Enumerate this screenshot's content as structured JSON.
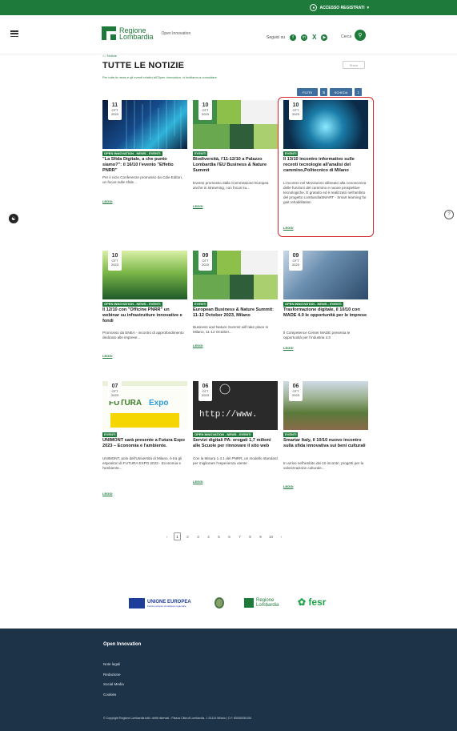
{
  "topbar": {
    "access_label": "ACCESSO REGISTRATI"
  },
  "header": {
    "logo_line1": "Regione",
    "logo_line2": "Lombardia",
    "logo_sub": "Open Innovation",
    "follow_label": "Seguici su",
    "social_icons": [
      "facebook-icon",
      "linkedin-icon",
      "x-icon",
      "youtube-icon"
    ],
    "search_label": "Cerca"
  },
  "page": {
    "breadcrumb": "/ Notizie",
    "title": "TUTTE LE NOTIZIE",
    "share_label": "Share"
  },
  "toolbar": {
    "filter_label": "FILTRI",
    "view_label": "SCHEDA"
  },
  "cards": [
    {
      "day": "11",
      "month": "OTT",
      "year": "2023",
      "tag": "OPEN INNOVATION - NEWS - EVENTI",
      "title": "\"La Sfida Digitale, a che punto siamo?\": il 16/10 l'evento \"Effetto PNRR\"",
      "text": "Per il ciclo Conferenze promosso da Cdie Editori, un focus sulle sfide...",
      "read": "LEGGI"
    },
    {
      "day": "10",
      "month": "OTT",
      "year": "2023",
      "tag": "EVENTI",
      "title": "Biodiversità, l'11-12/10 a Palazzo Lombardia l'EU Business & Nature Summit",
      "text": "Evento promosso dalla Commissione Europea anche in streaming, con focus su...",
      "read": "LEGGI"
    },
    {
      "day": "10",
      "month": "OTT",
      "year": "2023",
      "tag": "EVENTI",
      "title": "Il 13/10 incontro informativo sulle recenti tecnologie all'analisi del cammino,Politecnico di Milano",
      "text": "L'incontro nel Mezzanino allineato alla conoscenza delle funzioni del cammino e nuove prospettive tecnologiche. È gratuito ed è realizzato nell'ambito del progetto LombardiaSMART - Smart learning for gait rehabilitation",
      "read": "LEGGI"
    },
    {
      "day": "10",
      "month": "OTT",
      "year": "2023",
      "tag": "OPEN INNOVATION - NEWS - EVENTI",
      "title": "Il 12/10 con \"Officine PNRR\" un webinar su infrastrutture innovative e fondi",
      "text": "Promosso da ENEA - incontro di approfondimento dedicato alle imprese...",
      "read": "LEGGI"
    },
    {
      "day": "09",
      "month": "OTT",
      "year": "2023",
      "tag": "EVENTI",
      "title": "European Business & Nature Summit: 11-12 October 2023, Milano",
      "text": "Business and Nature Summit will take place in Milano, 11-12 October...",
      "read": "LEGGI"
    },
    {
      "day": "09",
      "month": "OTT",
      "year": "2023",
      "tag": "OPEN INNOVATION - NEWS - EVENTI",
      "title": "Trasformazione digitale, il 10/10 con MADE 4.0 le opportunità per le imprese",
      "text": "Il Competence Center MADE presenta le opportunità per l'industria 4.0",
      "read": "LEGGI"
    },
    {
      "day": "07",
      "month": "OTT",
      "year": "2023",
      "tag": "EVENTI",
      "title": "UNIMONT sarà presente a Futura Expo 2023 – Economia e l'ambiente.",
      "text": "UNIMONT, polo dell'Università di Milano, è tra gli espositori di FUTURA EXPO 2023 - Economia e l'ambiente...",
      "read": "LEGGI"
    },
    {
      "day": "06",
      "month": "OTT",
      "year": "2023",
      "tag": "OPEN INNOVATION - NEWS - EVENTI",
      "title": "Servizi digitali PA: erogati 1,7 milioni alle Scuole per rinnovare il sito web",
      "text": "Con la Misura 1.4.1 del PNRR, un modello standard per migliorare l'esperienza utente",
      "read": "LEGGI"
    },
    {
      "day": "06",
      "month": "OTT",
      "year": "2023",
      "tag": "EVENTI",
      "title": "Smartar Italy, il 10/10 nuovo incontro sulla sfida innovativa sui beni culturali",
      "text": "In arrivo nell'ambito dei 10 incontri, progetti per la valorizzazione culturale...",
      "read": "LEGGI"
    }
  ],
  "pagination": {
    "pages": [
      "‹",
      "1",
      "2",
      "3",
      "4",
      "5",
      "6",
      "7",
      "8",
      "9",
      "10",
      "›"
    ],
    "current": "1"
  },
  "partners": {
    "eu_line1": "UNIONE EUROPEA",
    "eu_line2": "Fondo europeo di sviluppo regionale",
    "rl_line1": "Regione",
    "rl_line2": "Lombardia",
    "fesr": "fesr"
  },
  "footer": {
    "title": "Open Innovation",
    "links": [
      "Note legali",
      "Redazione",
      "Social Media",
      "Cookies"
    ],
    "copyright": "© Copyright Regione Lombardia tutti i diritti riservati - Piazza Città di Lombardia, 1 20124 Milano | C.F. 80050050154"
  },
  "colors": {
    "brand_green": "#1e7a3a",
    "footer_bg": "#1c3348",
    "highlight_red": "#d62828"
  }
}
